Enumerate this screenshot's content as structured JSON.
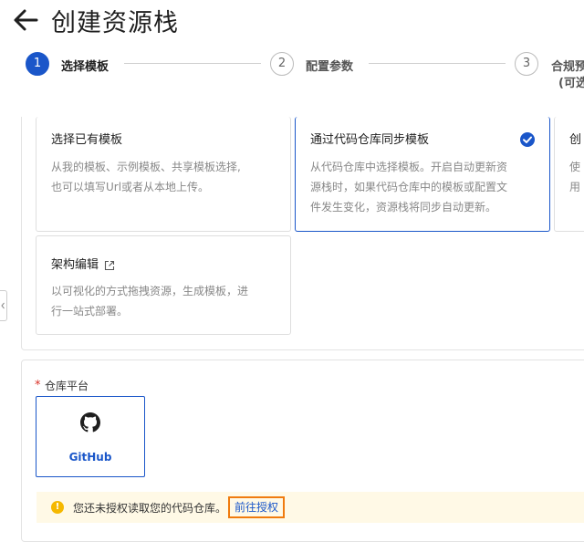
{
  "header": {
    "title": "创建资源栈"
  },
  "steps": [
    {
      "num": "1",
      "label": "选择模板"
    },
    {
      "num": "2",
      "label": "配置参数"
    },
    {
      "num": "3",
      "label": "合规预",
      "sub": "(可选"
    }
  ],
  "template_cards": [
    {
      "title": "选择已有模板",
      "desc": [
        "从我的模板、示例模板、共享模板选择,",
        "也可以填写Url或者从本地上传。"
      ],
      "selected": false
    },
    {
      "title": "通过代码仓库同步模板",
      "desc": [
        "从代码仓库中选择模板。开启自动更新资",
        "源栈时，如果代码仓库中的模板或配置文",
        "件发生变化，资源栈将同步自动更新。"
      ],
      "selected": true
    },
    {
      "title": "创",
      "desc": [
        "使",
        "用"
      ],
      "selected": false
    },
    {
      "title": "架构编辑",
      "desc": [
        "以可视化的方式拖拽资源，生成模板，进",
        "行一站式部署。"
      ],
      "selected": false
    }
  ],
  "repo": {
    "required_mark": "*",
    "label": "仓库平台",
    "platform": "GitHub"
  },
  "alert": {
    "text": "您还未授权读取您的代码仓库。",
    "link": "前往授权"
  },
  "colors": {
    "primary": "#1a56c9",
    "warning": "#f5b800",
    "highlight": "#f07b0e",
    "alert_bg": "#fff9e6"
  }
}
